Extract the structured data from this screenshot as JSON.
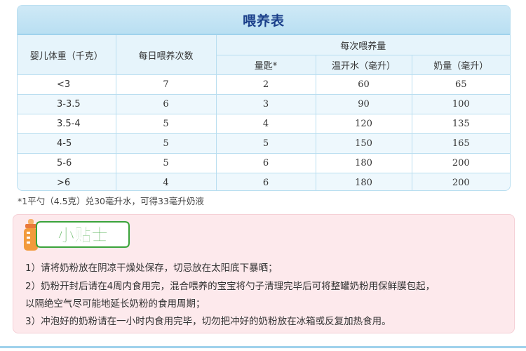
{
  "title": "喂养表",
  "headers": {
    "weight": "婴儿体重（千克）",
    "times": "每日喂养次数",
    "per_feed": "每次喂养量",
    "scoops": "量匙*",
    "water": "温开水（毫升）",
    "milk": "奶量（毫升）"
  },
  "rows": [
    {
      "weight": "<3",
      "times": "7",
      "scoops": "2",
      "water": "60",
      "milk": "65"
    },
    {
      "weight": "3-3.5",
      "times": "6",
      "scoops": "3",
      "water": "90",
      "milk": "100"
    },
    {
      "weight": "3.5-4",
      "times": "5",
      "scoops": "4",
      "water": "120",
      "milk": "135"
    },
    {
      "weight": "4-5",
      "times": "5",
      "scoops": "5",
      "water": "150",
      "milk": "165"
    },
    {
      "weight": "5-6",
      "times": "5",
      "scoops": "6",
      "water": "180",
      "milk": "200"
    },
    {
      "weight": ">6",
      "times": "4",
      "scoops": "6",
      "water": "180",
      "milk": "200"
    }
  ],
  "footnote": "*1平勺（4.5克）兑30毫升水，可得33毫升奶液",
  "tips": {
    "badge": "小贴士",
    "lines": [
      "1）请将奶粉放在阴凉干燥处保存，切忌放在太阳底下暴晒；",
      "2）奶粉开封后请在4周内食用完，混合喂养的宝宝将勺子清理完毕后可将整罐奶粉用保鲜膜包起，",
      "以隔绝空气尽可能地延长奶粉的食用周期；",
      "3）冲泡好的奶粉请在一小时内食用完毕，切勿把冲好的奶粉放在冰箱或反复加热食用。"
    ]
  },
  "colors": {
    "title_text": "#1a3f8a",
    "table_border": "#b9def0",
    "tips_bg": "#fde9ec",
    "badge_green": "#3aa33a",
    "bottle_orange": "#f29a3c"
  }
}
